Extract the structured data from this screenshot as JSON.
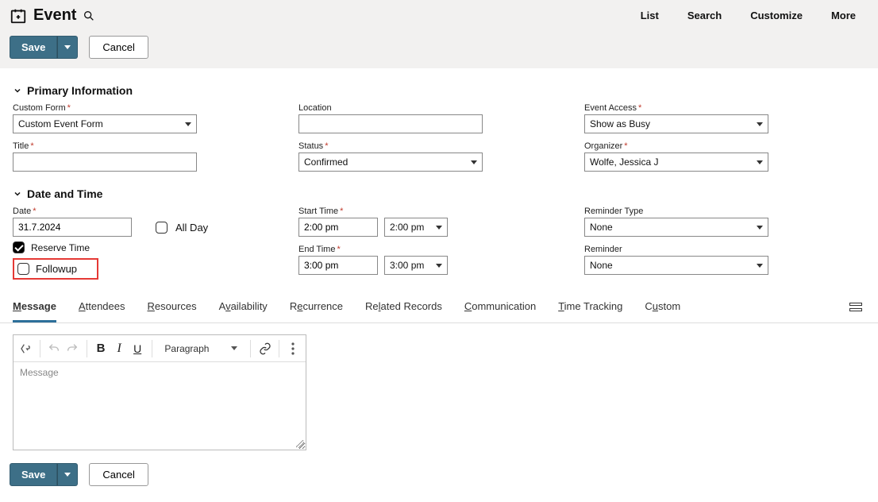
{
  "header": {
    "title": "Event",
    "nav": {
      "list": "List",
      "search": "Search",
      "customize": "Customize",
      "more": "More"
    }
  },
  "actions": {
    "save": "Save",
    "cancel": "Cancel"
  },
  "sections": {
    "primary": "Primary Information",
    "datetime": "Date and Time"
  },
  "primary": {
    "customForm": {
      "label": "Custom Form",
      "value": "Custom Event Form"
    },
    "title": {
      "label": "Title",
      "value": ""
    },
    "location": {
      "label": "Location",
      "value": ""
    },
    "status": {
      "label": "Status",
      "value": "Confirmed"
    },
    "eventAccess": {
      "label": "Event Access",
      "value": "Show as Busy"
    },
    "organizer": {
      "label": "Organizer",
      "value": "Wolfe, Jessica J"
    }
  },
  "datetime": {
    "date": {
      "label": "Date",
      "value": "31.7.2024"
    },
    "allDay": {
      "label": "All Day"
    },
    "reserveTime": {
      "label": "Reserve Time"
    },
    "followup": {
      "label": "Followup"
    },
    "startTime": {
      "label": "Start Time",
      "value": "2:00 pm",
      "select": "2:00 pm"
    },
    "endTime": {
      "label": "End Time",
      "value": "3:00 pm",
      "select": "3:00 pm"
    },
    "reminderType": {
      "label": "Reminder Type",
      "value": "None"
    },
    "reminder": {
      "label": "Reminder",
      "value": "None"
    }
  },
  "tabs": {
    "message": "Message",
    "attendees": "Attendees",
    "resources": "Resources",
    "availability": "Availability",
    "recurrence": "Recurrence",
    "related": "Related Records",
    "communication": "Communication",
    "time": "Time Tracking",
    "custom": "Custom"
  },
  "editor": {
    "paragraph": "Paragraph",
    "placeholder": "Message"
  }
}
